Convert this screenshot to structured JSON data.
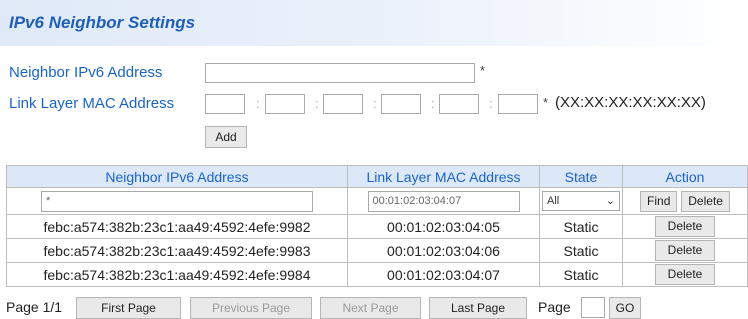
{
  "page": {
    "title": "IPv6 Neighbor Settings"
  },
  "form": {
    "ipv6_label": "Neighbor IPv6 Address",
    "ipv6_value": "",
    "ipv6_required": "*",
    "mac_label": "Link Layer MAC Address",
    "mac_octets": [
      "",
      "",
      "",
      "",
      "",
      ""
    ],
    "mac_separator": ":",
    "mac_required": "*",
    "mac_format_hint": "(XX:XX:XX:XX:XX:XX)",
    "add_label": "Add"
  },
  "table": {
    "columns": [
      "Neighbor IPv6 Address",
      "Link Layer MAC Address",
      "State",
      "Action"
    ],
    "filter": {
      "ipv6_value": "*",
      "mac_value": "00:01:02:03:04:07",
      "state_value": "All",
      "find_label": "Find",
      "delete_label": "Delete"
    },
    "rows": [
      {
        "ipv6": "febc:a574:382b:23c1:aa49:4592:4efe:9982",
        "mac": "00:01:02:03:04:05",
        "state": "Static",
        "action": "Delete"
      },
      {
        "ipv6": "febc:a574:382b:23c1:aa49:4592:4efe:9983",
        "mac": "00:01:02:03:04:06",
        "state": "Static",
        "action": "Delete"
      },
      {
        "ipv6": "febc:a574:382b:23c1:aa49:4592:4efe:9984",
        "mac": "00:01:02:03:04:07",
        "state": "Static",
        "action": "Delete"
      }
    ]
  },
  "pager": {
    "status": "Page 1/1",
    "first_label": "First Page",
    "previous_label": "Previous Page",
    "next_label": "Next Page",
    "last_label": "Last Page",
    "page_label": "Page",
    "page_value": "",
    "go_label": "GO"
  }
}
